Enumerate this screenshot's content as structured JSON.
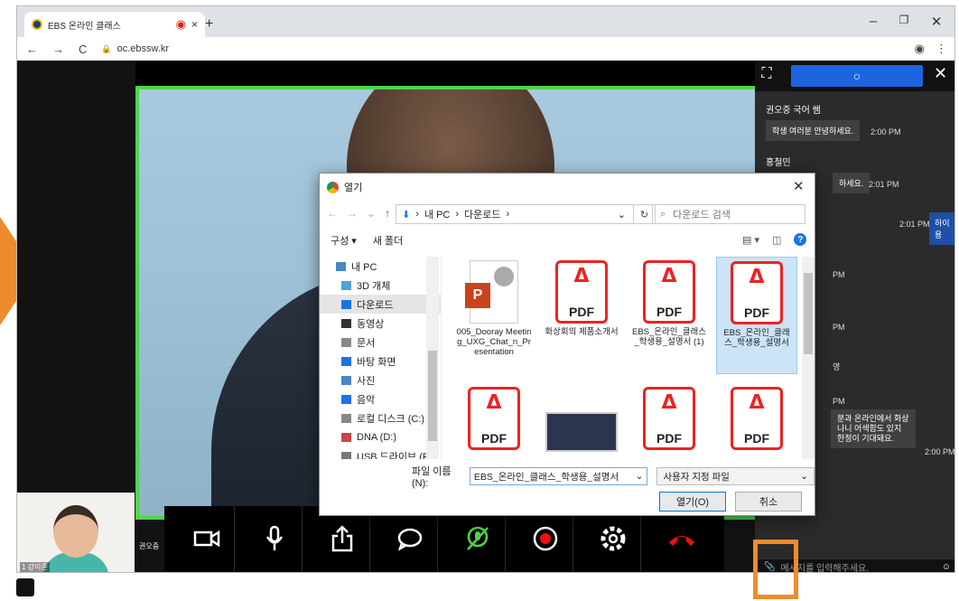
{
  "browser": {
    "tab_title": "EBS 온라인 클래스",
    "rec_icon": "record-dot-icon",
    "new_tab": "+",
    "url": "oc.ebssw.kr",
    "colors": {
      "accent_green": "#4cd64c",
      "highlight_orange": "#f08b2b",
      "chat_blue": "#1d64e0"
    }
  },
  "chat": {
    "messages": [
      {
        "name": "권오중 국어 쌤",
        "text": "학생 여러분 안녕하세요.",
        "time": "2:00 PM"
      },
      {
        "name": "홍철민",
        "text": "하세요.",
        "time": "2:01 PM"
      },
      {
        "text": "하이용",
        "time": "2:01 PM",
        "mine": true
      },
      {
        "time": "PM"
      },
      {
        "time": "PM"
      },
      {
        "text": "영"
      },
      {
        "time": "PM"
      },
      {
        "text": "분과 온라인에서 화상\n나니 어색함도 있지\n한정이 기대돼요.",
        "time": "2:00 PM"
      }
    ],
    "input_placeholder": "메시지를 입력해주세요."
  },
  "video": {
    "thumb_name": "1 강이준",
    "speaker_name": "권오중"
  },
  "toolbar": {
    "buttons": [
      "camera-icon",
      "microphone-icon",
      "share-screen-icon",
      "chat-icon",
      "mic-activity-icon",
      "record-icon",
      "settings-icon",
      "hangup-icon"
    ]
  },
  "dialog": {
    "title": "열기",
    "path": [
      "내 PC",
      "다운로드"
    ],
    "search_placeholder": "다운로드 검색",
    "organize": "구성 ▾",
    "new_folder": "새 폴더",
    "tree": [
      {
        "label": "내 PC"
      },
      {
        "label": "3D 개체"
      },
      {
        "label": "다운로드",
        "selected": true
      },
      {
        "label": "동영상"
      },
      {
        "label": "문서"
      },
      {
        "label": "바탕 화면"
      },
      {
        "label": "사진"
      },
      {
        "label": "음악"
      },
      {
        "label": "로컬 디스크 (C:)"
      },
      {
        "label": "DNA (D:)"
      },
      {
        "label": "USB 드라이브 (F"
      }
    ],
    "files": [
      {
        "name": "005_Dooray Meeting_UXG_Chat_n_Presentation",
        "type": "ppt"
      },
      {
        "name": "화상회의 제품소개서",
        "type": "pdf"
      },
      {
        "name": "EBS_온라인_클래스_학생용_설명서 (1)",
        "type": "pdf"
      },
      {
        "name": "EBS_온라인_클래스_학생용_설명서",
        "type": "pdf",
        "selected": true
      },
      {
        "name": "",
        "type": "pdf"
      },
      {
        "name": "",
        "type": "img"
      },
      {
        "name": "",
        "type": "pdf"
      },
      {
        "name": "",
        "type": "pdf"
      }
    ],
    "filename_label": "파일 이름(N):",
    "filename_value": "EBS_온라인_클래스_학생용_설명서",
    "filetype_value": "사용자 지정 파일",
    "open_label": "열기(O)",
    "cancel_label": "취소"
  }
}
